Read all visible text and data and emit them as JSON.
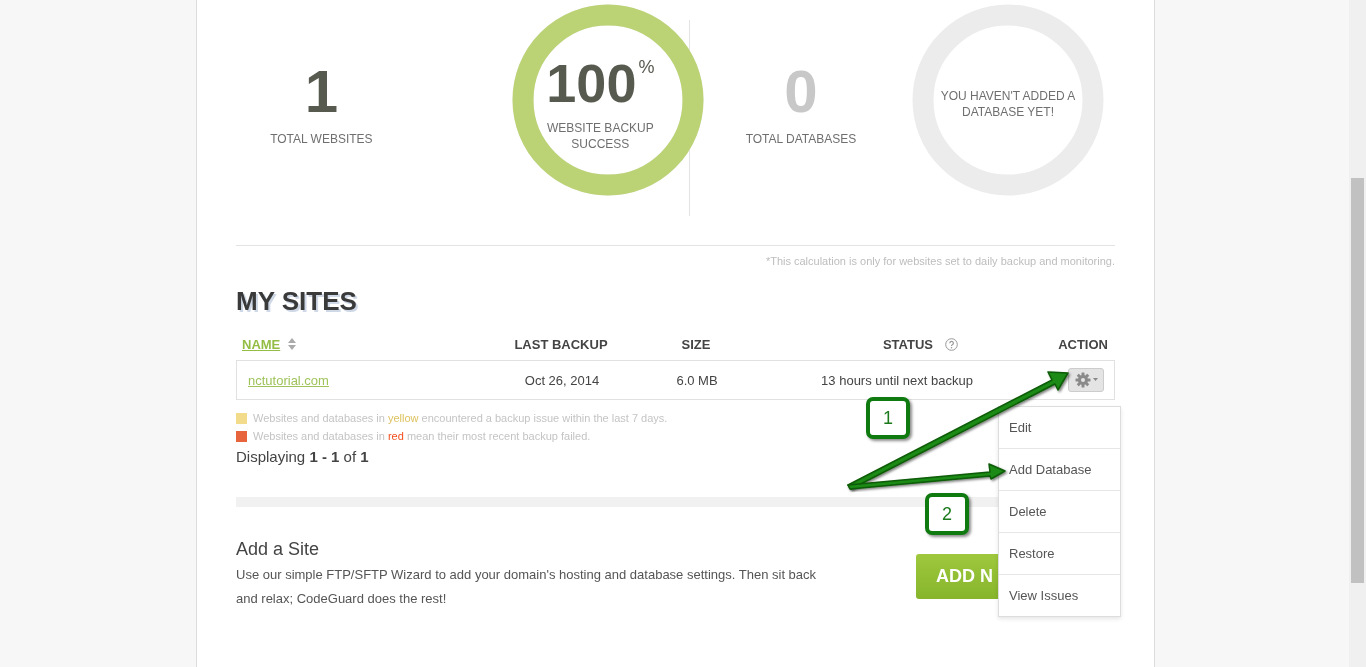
{
  "summary": {
    "websites": {
      "count": "1",
      "label": "TOTAL WEBSITES"
    },
    "backup_ring": {
      "value": "100",
      "unit": "%",
      "label": "WEBSITE BACKUP SUCCESS",
      "level": 1
    },
    "databases": {
      "count": "0",
      "label": "TOTAL DATABASES"
    },
    "database_ring": {
      "message": "YOU HAVEN'T ADDED A DATABASE YET!"
    },
    "footnote": "*This calculation is only for websites set to daily backup and monitoring."
  },
  "my_sites": {
    "title": "MY SITES",
    "columns": [
      {
        "label": "NAME",
        "selected": true,
        "sortable": true
      },
      {
        "label": "LAST BACKUP",
        "selected": false,
        "sortable": false
      },
      {
        "label": "SIZE",
        "selected": false,
        "sortable": false
      },
      {
        "label": "STATUS",
        "selected": false,
        "sortable": false,
        "help": true
      },
      {
        "label": "ACTION",
        "selected": false,
        "sortable": false
      }
    ],
    "rows": [
      {
        "name": "nctutorial.com",
        "last_backup": "Oct 26, 2014",
        "size": "6.0 MB",
        "status": "13 hours until next backup",
        "action_menu_expanded": true
      }
    ],
    "legend": [
      {
        "color": "#f2dc8c",
        "before": "Websites and databases in ",
        "word": "yellow",
        "after": " encountered a backup issue within the last 7 days."
      },
      {
        "color": "#e8643c",
        "before": "Websites and databases in ",
        "word": "red",
        "after": " mean their most recent backup failed."
      }
    ],
    "pagination": "Displaying **1 - 1** of **1**"
  },
  "add_site": {
    "title": "Add a Site",
    "description": "Use our simple FTP/SFTP Wizard to add your domain's hosting and database settings. Then sit back and relax; CodeGuard does the rest!",
    "button": "ADD N"
  },
  "action_menu": [
    {
      "label": "Edit"
    },
    {
      "label": "Add Database"
    },
    {
      "label": "Delete"
    },
    {
      "label": "Restore"
    },
    {
      "label": "View Issues"
    }
  ],
  "callouts": [
    {
      "label": "1"
    },
    {
      "label": "2"
    }
  ]
}
